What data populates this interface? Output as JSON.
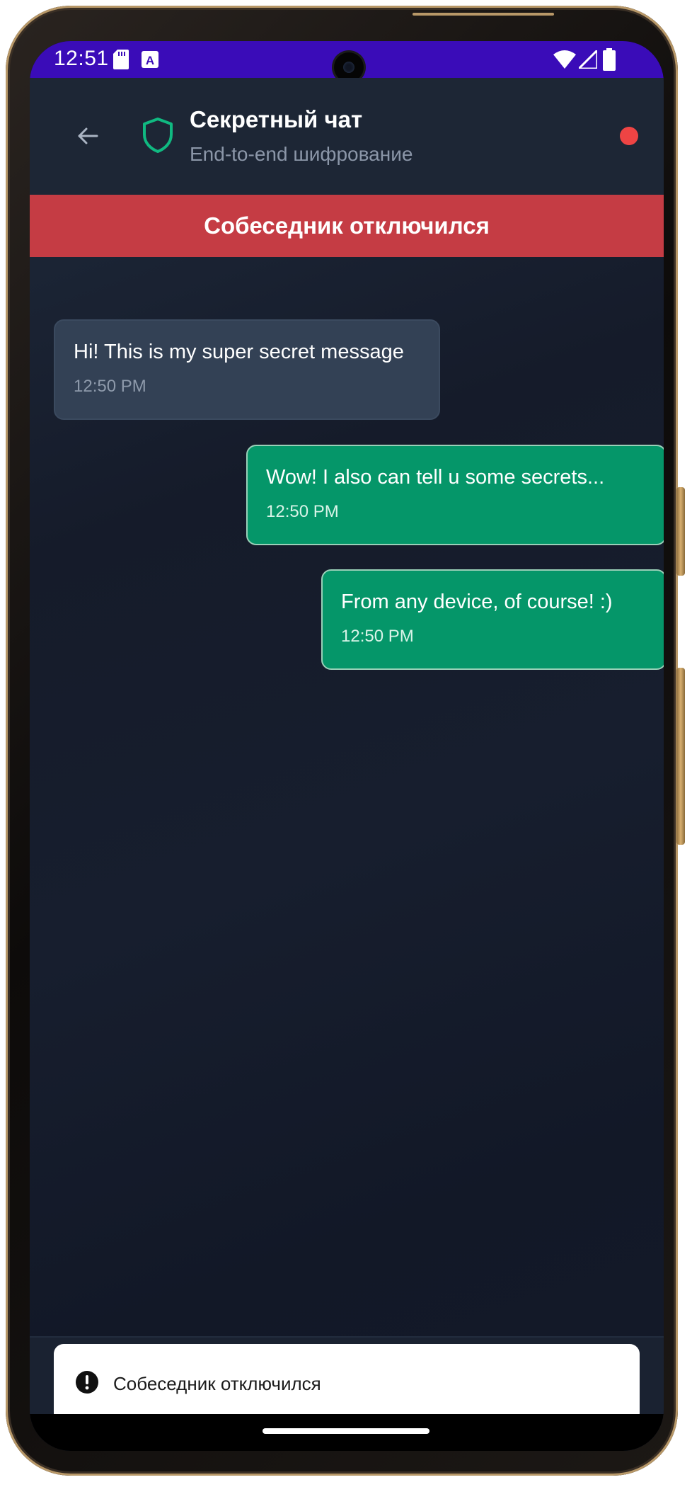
{
  "status_bar": {
    "time": "12:51",
    "left_icons": [
      "sd-card-icon",
      "keyboard-a-icon"
    ],
    "right_icons": [
      "wifi-icon",
      "signal-icon",
      "battery-icon"
    ],
    "background_color": "#3a0cb8"
  },
  "header": {
    "back_icon": "arrow-left-icon",
    "shield_icon": "shield-icon",
    "title": "Секретный чат",
    "subtitle": "End-to-end шифрование",
    "status_dot_color": "#ef4444"
  },
  "banner": {
    "text": "Собеседник отключился",
    "color": "#c53c44"
  },
  "messages": [
    {
      "direction": "incoming",
      "text": "Hi! This is my super secret message",
      "time": "12:50 PM"
    },
    {
      "direction": "outgoing",
      "text": "Wow! I also can tell u some secrets...",
      "time": "12:50 PM"
    },
    {
      "direction": "outgoing",
      "text": "From any device, of course! :)",
      "time": "12:50 PM"
    }
  ],
  "toast": {
    "icon": "alert-circle-icon",
    "text": "Собеседник отключился"
  },
  "colors": {
    "incoming_bubble": "#334155",
    "outgoing_bubble": "#059669",
    "accent_green": "#10b981"
  }
}
